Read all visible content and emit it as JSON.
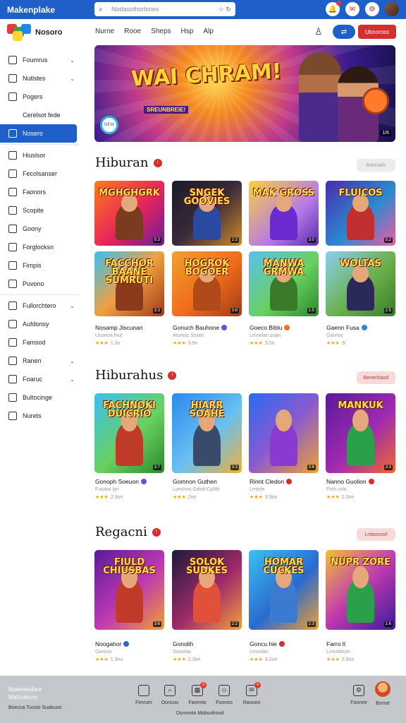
{
  "app": {
    "brand": "Makenplake",
    "search_placeholder": "Nodasothorlsnes",
    "search_right": "☆ ↻",
    "top_icons": [
      {
        "name": "notification-icon",
        "glyph": "🔔"
      },
      {
        "name": "chat-icon",
        "glyph": "✉"
      },
      {
        "name": "gamepad-icon",
        "glyph": "⚙"
      }
    ]
  },
  "header": {
    "logo_text": "Nosoro",
    "nav": [
      "Nurne",
      "Rooe",
      "Sheps",
      "Hsp",
      "Alp"
    ],
    "user_glyph": "♙",
    "btn_primary": "⇄",
    "btn_danger": "Ubnoross"
  },
  "sidebar": {
    "items": [
      {
        "label": "Foumrus",
        "chev": "⌄",
        "icon": "home-icon"
      },
      {
        "label": "Nutlstes",
        "chev": "⌄",
        "icon": "list-icon"
      },
      {
        "label": "Pogers",
        "chev": "",
        "icon": "bell-icon"
      },
      {
        "label": "Cerelsot fede",
        "chev": "",
        "icon": "none"
      },
      {
        "label": "Nosero",
        "chev": "",
        "icon": "grid-icon",
        "active": true
      },
      {
        "label": "Hiuslsor",
        "chev": "",
        "icon": "clock-icon"
      },
      {
        "label": "Fecolsanser",
        "chev": "",
        "icon": "doc-icon"
      },
      {
        "label": "Faonors",
        "chev": "",
        "icon": "folder-icon"
      },
      {
        "label": "Scopite",
        "chev": "",
        "icon": "chart-icon"
      },
      {
        "label": "Goony",
        "chev": "",
        "icon": "check-icon"
      },
      {
        "label": "Forglocksn",
        "chev": "",
        "icon": "shield-icon"
      },
      {
        "label": "Fimpis",
        "chev": "",
        "icon": "page-icon"
      },
      {
        "label": "Puvono",
        "chev": "",
        "icon": "box-icon"
      },
      {
        "label": "Fullorchtero",
        "chev": "⌄",
        "icon": "tag-icon"
      },
      {
        "label": "Aufdonsy",
        "chev": "",
        "icon": "card-icon"
      },
      {
        "label": "Famsod",
        "chev": "",
        "icon": "person-icon"
      },
      {
        "label": "Ranen",
        "chev": "⌄",
        "icon": "mail-icon"
      },
      {
        "label": "Foaruc",
        "chev": "⌄",
        "icon": "tool-icon"
      },
      {
        "label": "Bultocinge",
        "chev": "",
        "icon": "gift-icon"
      },
      {
        "label": "Nurets",
        "chev": "",
        "icon": "gear-icon"
      }
    ]
  },
  "banner": {
    "title": "WAI CHRAM!",
    "subtitle": "SREUNBREIE!",
    "badge": "NEW",
    "corner": "1/6"
  },
  "sections": [
    {
      "title": "Hiburan",
      "dot": "!",
      "button": "Bolsoalls",
      "button_style": "grey",
      "tiles": [
        {
          "text": "MGHGHGRK",
          "label": "5:3",
          "bg": "linear-gradient(135deg,#ff7a1a,#e5245b 55%,#6a1e9a)",
          "fig": "#7b3b1e"
        },
        {
          "text": "SNGEK GOOVIES",
          "label": "2:3",
          "bg": "linear-gradient(135deg,#1a1a2a,#3a2a3a 50%,#d08a2a)",
          "fig": "#2a4aa0"
        },
        {
          "text": "MAK GROSS",
          "label": "3:0",
          "bg": "linear-gradient(135deg,#ffcf3a,#b57be8 60%,#5a2ab0)",
          "fig": "#6a2ad0"
        },
        {
          "text": "FLUICOS",
          "label": "5:2",
          "bg": "linear-gradient(135deg,#4a2ab0,#2a8ad0 55%,#f25aa0)",
          "fig": "#c03030"
        },
        {
          "text": "FACCHOR BAANE SUMRUTI",
          "label": "3:3",
          "bg": "linear-gradient(135deg,#3ac0f0,#f0a040 50%,#a03a1a)",
          "fig": "#8a3a1a"
        },
        {
          "text": "HOGROK BOGOER",
          "label": "3:8",
          "bg": "linear-gradient(135deg,#f0a030,#f06a1a 55%,#a03a1a)",
          "fig": "#b04a1a"
        },
        {
          "text": "MANWA GRMWA",
          "label": "1:5",
          "bg": "linear-gradient(135deg,#5ac0f0,#6ad060 55%,#2a8a2a)",
          "fig": "#3a7a2a"
        },
        {
          "text": "WOLTAS",
          "label": "2:5",
          "bg": "linear-gradient(135deg,#8ad0f0,#6ab04a 55%,#3a7a2a)",
          "fig": "#2a2a5a"
        }
      ],
      "meta": [
        {
          "name": "Nosamp Jiscunan",
          "badge": "",
          "sub": "Ltuseoa lnut",
          "stars": "★★★",
          "rating": "1.3n"
        },
        {
          "name": "Gonuch Bauhone",
          "badge": "#7a4ad0",
          "sub": "Atumsc Sisten",
          "stars": "★★★",
          "rating": "3.9n"
        },
        {
          "name": "Goeco Biblu",
          "badge": "#f0702a",
          "sub": "Lmnelan soan",
          "stars": "★★★",
          "rating": "3.5n"
        },
        {
          "name": "Gaenn Fusa",
          "badge": "#2a8ad0",
          "sub": "Ganroo",
          "stars": "★★★",
          "rating": "3/"
        }
      ]
    },
    {
      "title": "Hiburahus",
      "dot": "!",
      "button": "Benenhasd",
      "button_style": "pink",
      "tiles": [
        {
          "text": "FACHNOKI DUICRIO",
          "label": "3:7",
          "bg": "linear-gradient(135deg,#3ac0f0,#6ad060 55%,#2a8a2a)",
          "fig": "#c03a2a"
        },
        {
          "text": "HIARR SOAHE",
          "label": "3:3",
          "bg": "linear-gradient(135deg,#2a8af0,#6ac0f0 55%,#f0b03a)",
          "fig": "#3a4a6a"
        },
        {
          "text": "",
          "label": "3:6",
          "bg": "linear-gradient(135deg,#2a6af0,#8a5ad0 50%,#f0a030)",
          "fig": "#8a3ad0"
        },
        {
          "text": "MANKUK",
          "label": "3:3",
          "bg": "linear-gradient(135deg,#5a1a9a,#a02ab0 55%,#f06a2a)",
          "fig": "#2aa04a"
        }
      ],
      "meta": [
        {
          "name": "Gonoph Soeuon",
          "badge": "#7a4ad0",
          "sub": "Fuiutiol lpn",
          "stars": "★★★",
          "rating": "2.3on"
        },
        {
          "name": "Gomnon Guthen",
          "badge": "",
          "sub": "Lonchos Gdsilt CpNb",
          "stars": "★★★",
          "rating": "2on"
        },
        {
          "name": "Rinnt Cledon",
          "badge": "#d03030",
          "sub": "Lrntsfe",
          "stars": "★★★",
          "rating": "3.3on"
        },
        {
          "name": "Nanno Guolion",
          "badge": "#d03030",
          "sub": "Frzh colo",
          "stars": "★★★",
          "rating": "2.3on"
        }
      ]
    },
    {
      "title": "Regacni",
      "dot": "!",
      "button": "Lmboscorl",
      "button_style": "pink",
      "tiles": [
        {
          "text": "FIULD CHIUSBAS",
          "label": "3:6",
          "bg": "linear-gradient(135deg,#5a1a9a,#c03ab0 55%,#f0a030)",
          "fig": "#c03a2a"
        },
        {
          "text": "SOLOK SUDKES",
          "label": "2:2",
          "bg": "linear-gradient(135deg,#1a1a3a,#a02a6a 55%,#f0a03a)",
          "fig": "#e0503a"
        },
        {
          "text": "HOMAR CUCKES",
          "label": "2:3",
          "bg": "linear-gradient(135deg,#3ac0f0,#2a6ad0 55%,#f0a030)",
          "fig": "#3a7ad0"
        },
        {
          "text": "NUPR ZORE",
          "label": "1:6",
          "bg": "linear-gradient(135deg,#f0c03a,#c03ab0 50%,#3a1a9a)",
          "fig": "#2aa04a"
        }
      ],
      "meta": [
        {
          "name": "Noogahor",
          "badge": "#2a6ad0",
          "sub": "Ganroo",
          "stars": "★★★",
          "rating": "1.3no"
        },
        {
          "name": "Gonolih",
          "badge": "",
          "sub": "Ssinolac",
          "stars": "★★★",
          "rating": "2.3on"
        },
        {
          "name": "Goncu hie",
          "badge": "#d03030",
          "sub": "Lmnolan",
          "stars": "★★★",
          "rating": "3.2on"
        },
        {
          "name": "Farro Il",
          "badge": "",
          "sub": "Lmnsldcon",
          "stars": "★★★",
          "rating": "2.3on"
        }
      ]
    }
  ],
  "bottombar": {
    "left_line1": "Nakeolasfare",
    "left_line2": "Mafcutecno",
    "left_line3": "Boecca Tussio Suabuoo",
    "items": [
      {
        "label": "Fimrom",
        "glyph": "",
        "badge": ""
      },
      {
        "label": "Ooncuo",
        "glyph": "⌕",
        "badge": ""
      },
      {
        "label": "Fammio",
        "glyph": "▦",
        "badge": "3"
      },
      {
        "label": "Fooneo",
        "glyph": "☺",
        "badge": ""
      },
      {
        "label": "Raooeo",
        "glyph": "✉",
        "badge": "4"
      },
      {
        "label": "Foonee",
        "glyph": "⚙",
        "badge": ""
      },
      {
        "label": "Bsnoe",
        "glyph": "",
        "badge": ""
      }
    ],
    "caption": "Domnnto Mobsofrond"
  }
}
